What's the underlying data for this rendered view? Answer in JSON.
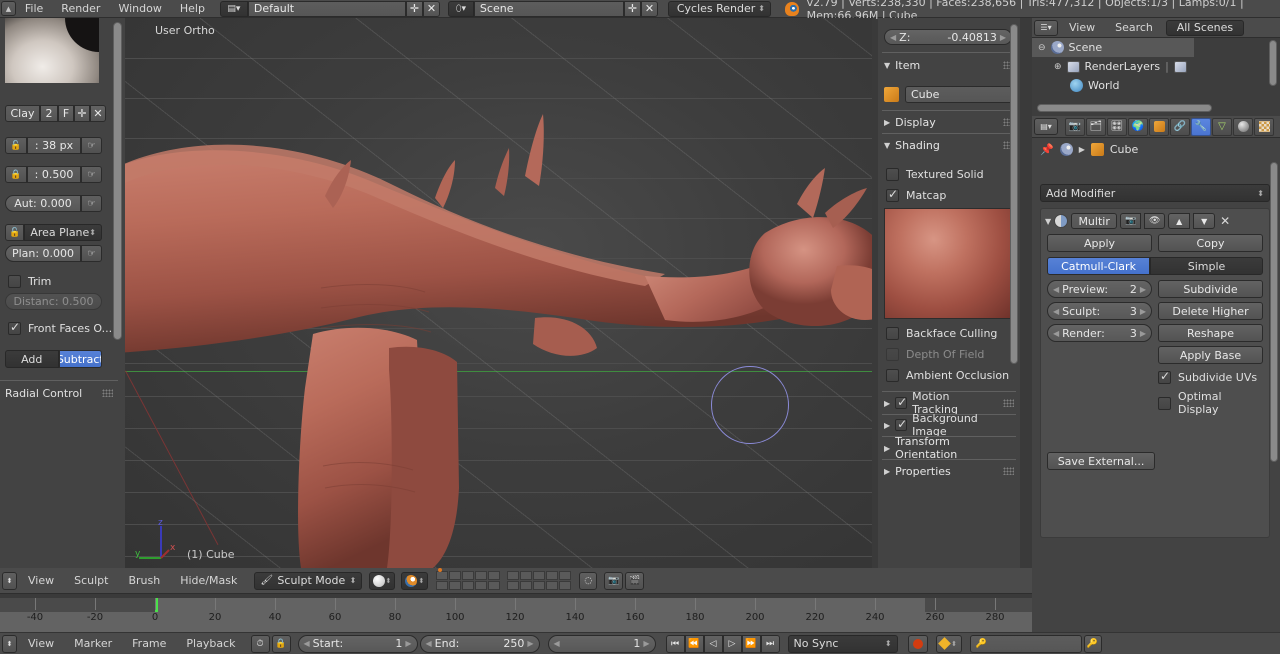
{
  "topbar": {
    "menus": [
      "File",
      "Render",
      "Window",
      "Help"
    ],
    "screen_layout": "Default",
    "scene_name": "Scene",
    "render_engine": "Cycles Render",
    "stats": "v2.79 | Verts:238,330 | Faces:238,656 | Tris:477,312 | Objects:1/3 | Lamps:0/1 | Mem:66.96M | Cube"
  },
  "toolshelf": {
    "brush_name": "Clay",
    "brush_users": "2",
    "fake_user": "F",
    "radius": ": 38 px",
    "strength": ": 0.500",
    "autosmooth": "Aut: 0.000",
    "sculpt_plane": "Area Plane",
    "plane_offset": "Plan: 0.000",
    "trim_label": "Trim",
    "trim_checked": false,
    "distance": "Distanc: 0.500",
    "front_faces": "Front Faces O...",
    "front_faces_checked": true,
    "add_label": "Add",
    "subtract_label": "Subtract",
    "subtract_active": true,
    "radial_control": "Radial Control"
  },
  "viewport": {
    "view_label": "User Ortho",
    "object_label": "(1) Cube",
    "axis_x": "x",
    "axis_y": "y",
    "axis_z": "z"
  },
  "npanel": {
    "transform_z": {
      "label": "Z:",
      "value": "-0.40813"
    },
    "item": {
      "title": "Item",
      "open": true,
      "object_name": "Cube"
    },
    "display": {
      "title": "Display",
      "open": false
    },
    "shading": {
      "title": "Shading",
      "open": true,
      "textured_solid": {
        "label": "Textured Solid",
        "checked": false
      },
      "matcap": {
        "label": "Matcap",
        "checked": true
      },
      "backface_culling": {
        "label": "Backface Culling",
        "checked": false
      },
      "depth_of_field": {
        "label": "Depth Of Field",
        "checked": false,
        "disabled": true
      },
      "ambient_occlusion": {
        "label": "Ambient Occlusion",
        "checked": false
      }
    },
    "motion_tracking": {
      "title": "Motion Tracking",
      "checked": true,
      "open": false
    },
    "background_image": {
      "title": "Background Image",
      "checked": true,
      "open": false
    },
    "transform_orientation": {
      "title": "Transform Orientation",
      "open": false
    },
    "properties": {
      "title": "Properties",
      "open": false
    }
  },
  "outliner": {
    "header": {
      "view": "View",
      "search": "Search",
      "display_mode": "All Scenes"
    },
    "rows": [
      {
        "label": "Scene",
        "icon": "scene-icon",
        "indent": 0,
        "selected": true
      },
      {
        "label": "RenderLayers",
        "icon": "renderlayers-icon",
        "indent": 1,
        "selected": false
      },
      {
        "label": "World",
        "icon": "world-icon",
        "indent": 2,
        "selected": false
      }
    ]
  },
  "properties": {
    "tabs": [
      "render-icon",
      "renderlayers-icon",
      "scene-icon",
      "world-icon",
      "object-icon",
      "constraints-icon",
      "modifier-icon",
      "data-icon",
      "material-icon",
      "texture-icon"
    ],
    "active_tab_index": 6,
    "breadcrumb_object": "Cube",
    "add_modifier": "Add Modifier",
    "modifier": {
      "name": "Multir",
      "apply": "Apply",
      "copy": "Copy",
      "subdivision_type": [
        "Catmull-Clark",
        "Simple"
      ],
      "subdivision_active": "Catmull-Clark",
      "levels": [
        {
          "label": "Preview:",
          "value": "2"
        },
        {
          "label": "Sculpt:",
          "value": "3"
        },
        {
          "label": "Render:",
          "value": "3"
        }
      ],
      "actions": [
        "Subdivide",
        "Delete Higher",
        "Reshape",
        "Apply Base"
      ],
      "subdivide_uvs": {
        "label": "Subdivide UVs",
        "checked": true
      },
      "optimal_display": {
        "label": "Optimal Display",
        "checked": false
      },
      "save_external": "Save External..."
    }
  },
  "viewport_footer": {
    "menus": [
      "View",
      "Sculpt",
      "Brush",
      "Hide/Mask"
    ],
    "mode": "Sculpt Mode"
  },
  "timeline_ruler": {
    "ticks": [
      -40,
      -20,
      0,
      20,
      40,
      60,
      80,
      100,
      120,
      140,
      160,
      180,
      200,
      220,
      240,
      260,
      280
    ],
    "current_frame": 1,
    "range_start": 1,
    "range_end": 250
  },
  "timeline_footer": {
    "menus": [
      "View",
      "Marker",
      "Frame",
      "Playback"
    ],
    "start_label": "Start:",
    "start_value": "1",
    "end_label": "End:",
    "end_value": "250",
    "current_frame_value": "1",
    "sync_mode": "No Sync"
  }
}
